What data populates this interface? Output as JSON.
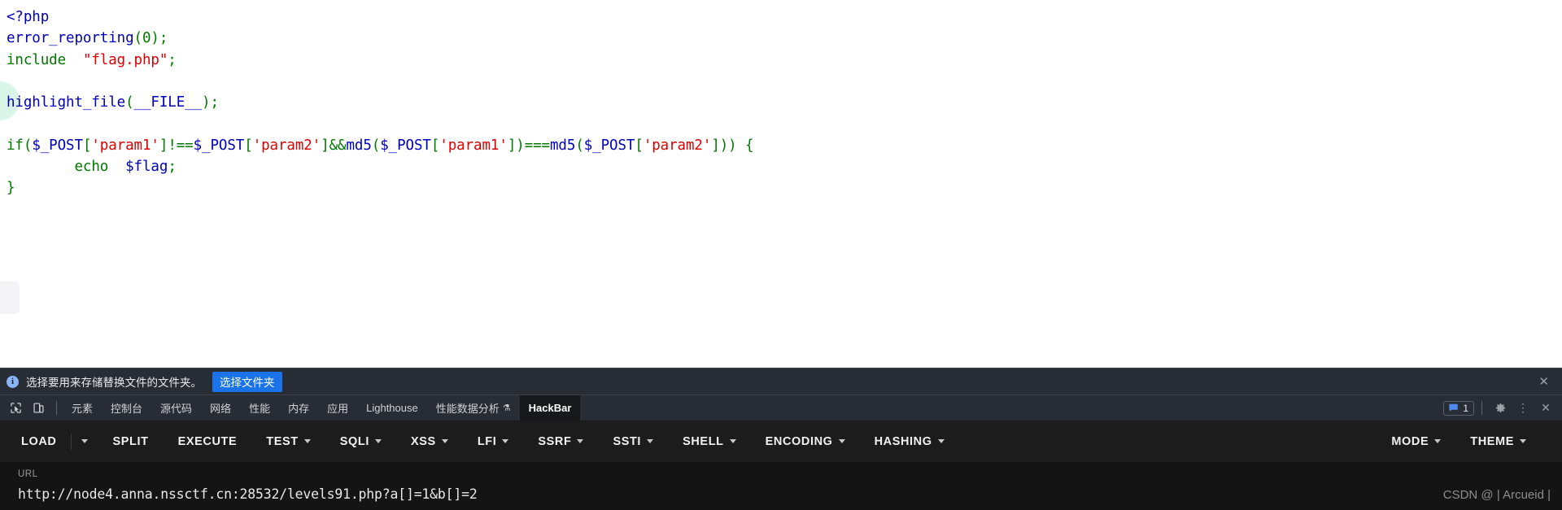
{
  "page": {
    "code_lines": [
      [
        {
          "t": "<?php",
          "c": "kw"
        }
      ],
      [
        {
          "t": "error_reporting",
          "c": "fn"
        },
        {
          "t": "(",
          "c": "punct"
        },
        {
          "t": "0",
          "c": "punct"
        },
        {
          "t": ")",
          "c": "punct"
        },
        {
          "t": ";",
          "c": "punct"
        }
      ],
      [
        {
          "t": "include",
          "c": "plain"
        },
        {
          "t": "  ",
          "c": "plain"
        },
        {
          "t": "\"flag.php\"",
          "c": "str"
        },
        {
          "t": ";",
          "c": "punct"
        }
      ],
      [
        {
          "t": "",
          "c": "plain"
        }
      ],
      [
        {
          "t": "highlight_file",
          "c": "fn"
        },
        {
          "t": "(",
          "c": "punct"
        },
        {
          "t": "__FILE__",
          "c": "fn"
        },
        {
          "t": ")",
          "c": "punct"
        },
        {
          "t": ";",
          "c": "punct"
        }
      ],
      [
        {
          "t": "",
          "c": "plain"
        }
      ],
      [
        {
          "t": "if",
          "c": "plain"
        },
        {
          "t": "(",
          "c": "punct"
        },
        {
          "t": "$_POST",
          "c": "var"
        },
        {
          "t": "[",
          "c": "punct"
        },
        {
          "t": "'param1'",
          "c": "str"
        },
        {
          "t": "]",
          "c": "punct"
        },
        {
          "t": "!==",
          "c": "punct"
        },
        {
          "t": "$_POST",
          "c": "var"
        },
        {
          "t": "[",
          "c": "punct"
        },
        {
          "t": "'param2'",
          "c": "str"
        },
        {
          "t": "]",
          "c": "punct"
        },
        {
          "t": "&&",
          "c": "punct"
        },
        {
          "t": "md5",
          "c": "fn"
        },
        {
          "t": "(",
          "c": "punct"
        },
        {
          "t": "$_POST",
          "c": "var"
        },
        {
          "t": "[",
          "c": "punct"
        },
        {
          "t": "'param1'",
          "c": "str"
        },
        {
          "t": "]",
          "c": "punct"
        },
        {
          "t": ")",
          "c": "punct"
        },
        {
          "t": "===",
          "c": "punct"
        },
        {
          "t": "md5",
          "c": "fn"
        },
        {
          "t": "(",
          "c": "punct"
        },
        {
          "t": "$_POST",
          "c": "var"
        },
        {
          "t": "[",
          "c": "punct"
        },
        {
          "t": "'param2'",
          "c": "str"
        },
        {
          "t": "]",
          "c": "punct"
        },
        {
          "t": "))",
          "c": "punct"
        },
        {
          "t": " {",
          "c": "punct"
        }
      ],
      [
        {
          "t": "        ",
          "c": "plain"
        },
        {
          "t": "echo",
          "c": "plain"
        },
        {
          "t": "  ",
          "c": "plain"
        },
        {
          "t": "$flag",
          "c": "var"
        },
        {
          "t": ";",
          "c": "punct"
        }
      ],
      [
        {
          "t": "}",
          "c": "punct"
        }
      ]
    ],
    "colors": {
      "keyword": "#0000BB",
      "function": "#0000BB",
      "punctuation": "#007700",
      "string": "#DD0000",
      "variable": "#0000BB",
      "background": "#FFFFFF"
    }
  },
  "devtools": {
    "notification": {
      "icon": "info-icon",
      "message": "选择要用来存储替换文件的文件夹。",
      "action_label": "选择文件夹",
      "close_icon": "close-icon"
    },
    "toolbar_icons": {
      "inspect": "inspect-element-icon",
      "device": "device-toolbar-icon"
    },
    "tabs": [
      {
        "label": "元素",
        "active": false,
        "icon": null
      },
      {
        "label": "控制台",
        "active": false,
        "icon": null
      },
      {
        "label": "源代码",
        "active": false,
        "icon": null
      },
      {
        "label": "网络",
        "active": false,
        "icon": null
      },
      {
        "label": "性能",
        "active": false,
        "icon": null
      },
      {
        "label": "内存",
        "active": false,
        "icon": null
      },
      {
        "label": "应用",
        "active": false,
        "icon": null
      },
      {
        "label": "Lighthouse",
        "active": false,
        "icon": null
      },
      {
        "label": "性能数据分析",
        "active": false,
        "icon": "flask-icon"
      },
      {
        "label": "HackBar",
        "active": true,
        "icon": null
      }
    ],
    "right_actions": {
      "message_icon": "message-icon",
      "message_count": "1",
      "settings_icon": "gear-icon",
      "more_icon": "kebab-menu-icon",
      "close_icon": "close-icon"
    },
    "accent_blue": "#1a73e8"
  },
  "hackbar": {
    "items": [
      {
        "label": "LOAD",
        "caret": false,
        "split_caret": true
      },
      {
        "label": "SPLIT",
        "caret": false,
        "split_caret": false
      },
      {
        "label": "EXECUTE",
        "caret": false,
        "split_caret": false
      },
      {
        "label": "TEST",
        "caret": true,
        "split_caret": false
      },
      {
        "label": "SQLI",
        "caret": true,
        "split_caret": false
      },
      {
        "label": "XSS",
        "caret": true,
        "split_caret": false
      },
      {
        "label": "LFI",
        "caret": true,
        "split_caret": false
      },
      {
        "label": "SSRF",
        "caret": true,
        "split_caret": false
      },
      {
        "label": "SSTI",
        "caret": true,
        "split_caret": false
      },
      {
        "label": "SHELL",
        "caret": true,
        "split_caret": false
      },
      {
        "label": "ENCODING",
        "caret": true,
        "split_caret": false
      },
      {
        "label": "HASHING",
        "caret": true,
        "split_caret": false
      }
    ],
    "right_items": [
      {
        "label": "MODE",
        "caret": true
      },
      {
        "label": "THEME",
        "caret": true
      }
    ],
    "url": {
      "label": "URL",
      "value": "http://node4.anna.nssctf.cn:28532/levels91.php?a[]=1&b[]=2"
    }
  },
  "watermark": {
    "text": "CSDN @ | Arcueid |"
  }
}
